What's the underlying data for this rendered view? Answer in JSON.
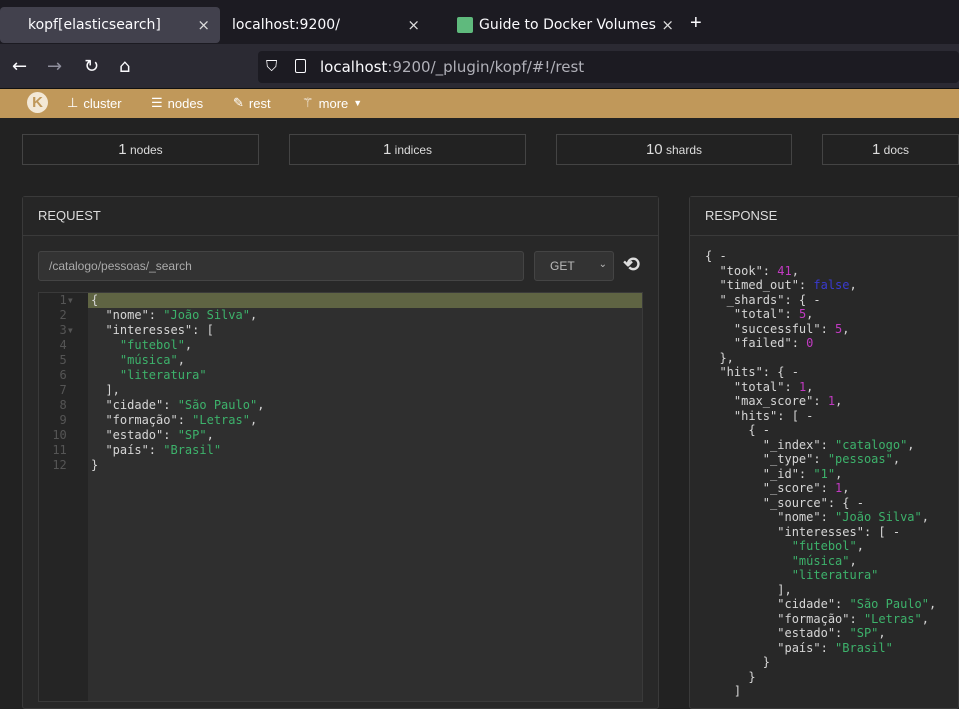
{
  "browser": {
    "tabs": [
      {
        "label": "kopf[elasticsearch]",
        "active": true
      },
      {
        "label": "localhost:9200/"
      },
      {
        "label": "Guide to Docker Volumes",
        "icon": "leaf-favicon"
      }
    ],
    "url_host": "localhost",
    "url_rest": ":9200/_plugin/kopf/#!/rest"
  },
  "nav": {
    "items": [
      {
        "label": "cluster",
        "icon": "sitemap-icon"
      },
      {
        "label": "nodes",
        "icon": "server-icon"
      },
      {
        "label": "rest",
        "icon": "edit-icon"
      },
      {
        "label": "more",
        "icon": "magic-wand-icon"
      }
    ],
    "accent": "#c0985a"
  },
  "stats": [
    {
      "value": "1",
      "unit": "nodes"
    },
    {
      "value": "1",
      "unit": "indices"
    },
    {
      "value": "10",
      "unit": "shards"
    },
    {
      "value": "1",
      "unit": "docs"
    }
  ],
  "request": {
    "title": "REQUEST",
    "path": "/catalogo/pessoas/_search",
    "method": "GET",
    "lines": [
      [
        [
          "p",
          "{"
        ]
      ],
      [
        [
          "k",
          "  \"nome\""
        ],
        [
          "p",
          ": "
        ],
        [
          "s",
          "\"João Silva\""
        ],
        [
          "p",
          ","
        ]
      ],
      [
        [
          "k",
          "  \"interesses\""
        ],
        [
          "p",
          ": ["
        ]
      ],
      [
        [
          "s",
          "    \"futebol\""
        ],
        [
          "p",
          ","
        ]
      ],
      [
        [
          "s",
          "    \"música\""
        ],
        [
          "p",
          ","
        ]
      ],
      [
        [
          "s",
          "    \"literatura\""
        ]
      ],
      [
        [
          "p",
          "  ],"
        ]
      ],
      [
        [
          "k",
          "  \"cidade\""
        ],
        [
          "p",
          ": "
        ],
        [
          "s",
          "\"São Paulo\""
        ],
        [
          "p",
          ","
        ]
      ],
      [
        [
          "k",
          "  \"formação\""
        ],
        [
          "p",
          ": "
        ],
        [
          "s",
          "\"Letras\""
        ],
        [
          "p",
          ","
        ]
      ],
      [
        [
          "k",
          "  \"estado\""
        ],
        [
          "p",
          ": "
        ],
        [
          "s",
          "\"SP\""
        ],
        [
          "p",
          ","
        ]
      ],
      [
        [
          "k",
          "  \"país\""
        ],
        [
          "p",
          ": "
        ],
        [
          "s",
          "\"Brasil\""
        ]
      ],
      [
        [
          "p",
          "}"
        ]
      ]
    ]
  },
  "response": {
    "title": "RESPONSE",
    "lines": [
      [
        [
          "p",
          "{ -"
        ]
      ],
      [
        [
          "k",
          "  \"took\""
        ],
        [
          "p",
          ": "
        ],
        [
          "n",
          "41"
        ],
        [
          "p",
          ","
        ]
      ],
      [
        [
          "k",
          "  \"timed_out\""
        ],
        [
          "p",
          ": "
        ],
        [
          "b",
          "false"
        ],
        [
          "p",
          ","
        ]
      ],
      [
        [
          "k",
          "  \"_shards\""
        ],
        [
          "p",
          ": { -"
        ]
      ],
      [
        [
          "k",
          "    \"total\""
        ],
        [
          "p",
          ": "
        ],
        [
          "n",
          "5"
        ],
        [
          "p",
          ","
        ]
      ],
      [
        [
          "k",
          "    \"successful\""
        ],
        [
          "p",
          ": "
        ],
        [
          "n",
          "5"
        ],
        [
          "p",
          ","
        ]
      ],
      [
        [
          "k",
          "    \"failed\""
        ],
        [
          "p",
          ": "
        ],
        [
          "n",
          "0"
        ]
      ],
      [
        [
          "p",
          "  },"
        ]
      ],
      [
        [
          "k",
          "  \"hits\""
        ],
        [
          "p",
          ": { -"
        ]
      ],
      [
        [
          "k",
          "    \"total\""
        ],
        [
          "p",
          ": "
        ],
        [
          "n",
          "1"
        ],
        [
          "p",
          ","
        ]
      ],
      [
        [
          "k",
          "    \"max_score\""
        ],
        [
          "p",
          ": "
        ],
        [
          "n",
          "1"
        ],
        [
          "p",
          ","
        ]
      ],
      [
        [
          "k",
          "    \"hits\""
        ],
        [
          "p",
          ": [ -"
        ]
      ],
      [
        [
          "p",
          "      { -"
        ]
      ],
      [
        [
          "k",
          "        \"_index\""
        ],
        [
          "p",
          ": "
        ],
        [
          "s",
          "\"catalogo\""
        ],
        [
          "p",
          ","
        ]
      ],
      [
        [
          "k",
          "        \"_type\""
        ],
        [
          "p",
          ": "
        ],
        [
          "s",
          "\"pessoas\""
        ],
        [
          "p",
          ","
        ]
      ],
      [
        [
          "k",
          "        \"_id\""
        ],
        [
          "p",
          ": "
        ],
        [
          "s",
          "\"1\""
        ],
        [
          "p",
          ","
        ]
      ],
      [
        [
          "k",
          "        \"_score\""
        ],
        [
          "p",
          ": "
        ],
        [
          "n",
          "1"
        ],
        [
          "p",
          ","
        ]
      ],
      [
        [
          "k",
          "        \"_source\""
        ],
        [
          "p",
          ": { -"
        ]
      ],
      [
        [
          "k",
          "          \"nome\""
        ],
        [
          "p",
          ": "
        ],
        [
          "s",
          "\"João Silva\""
        ],
        [
          "p",
          ","
        ]
      ],
      [
        [
          "k",
          "          \"interesses\""
        ],
        [
          "p",
          ": [ -"
        ]
      ],
      [
        [
          "s",
          "            \"futebol\""
        ],
        [
          "p",
          ","
        ]
      ],
      [
        [
          "s",
          "            \"música\""
        ],
        [
          "p",
          ","
        ]
      ],
      [
        [
          "s",
          "            \"literatura\""
        ]
      ],
      [
        [
          "p",
          "          ],"
        ]
      ],
      [
        [
          "k",
          "          \"cidade\""
        ],
        [
          "p",
          ": "
        ],
        [
          "s",
          "\"São Paulo\""
        ],
        [
          "p",
          ","
        ]
      ],
      [
        [
          "k",
          "          \"formação\""
        ],
        [
          "p",
          ": "
        ],
        [
          "s",
          "\"Letras\""
        ],
        [
          "p",
          ","
        ]
      ],
      [
        [
          "k",
          "          \"estado\""
        ],
        [
          "p",
          ": "
        ],
        [
          "s",
          "\"SP\""
        ],
        [
          "p",
          ","
        ]
      ],
      [
        [
          "k",
          "          \"país\""
        ],
        [
          "p",
          ": "
        ],
        [
          "s",
          "\"Brasil\""
        ]
      ],
      [
        [
          "p",
          "        }"
        ]
      ],
      [
        [
          "p",
          "      }"
        ]
      ],
      [
        [
          "p",
          "    ]"
        ]
      ]
    ]
  }
}
